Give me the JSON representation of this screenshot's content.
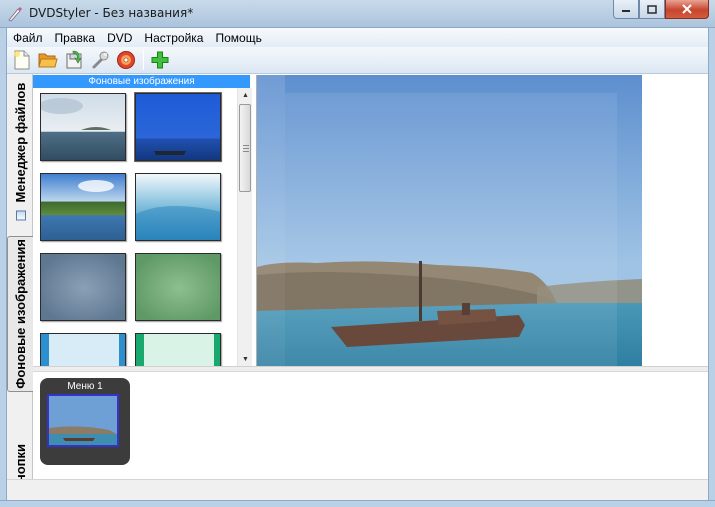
{
  "window": {
    "title": "DVDStyler - Без названия*"
  },
  "menubar": {
    "items": [
      "Файл",
      "Правка",
      "DVD",
      "Настройка",
      "Помощь"
    ]
  },
  "toolbar": {
    "buttons": [
      "new-document-icon",
      "open-folder-icon",
      "save-icon",
      "settings-wrench-icon",
      "burn-disc-icon",
      "add-icon"
    ]
  },
  "side_tabs": {
    "files": "Менеджер файлов",
    "backgrounds": "Фоновые изображения",
    "buttons": "Кнопки"
  },
  "panel": {
    "header": "Фоновые изображения"
  },
  "menus": {
    "items": [
      {
        "label": "Меню 1"
      }
    ]
  },
  "colors": {
    "panel_header": "#3399ff",
    "menu_card_bg": "#3c3c3c",
    "menu_card_border": "#3333cc"
  }
}
